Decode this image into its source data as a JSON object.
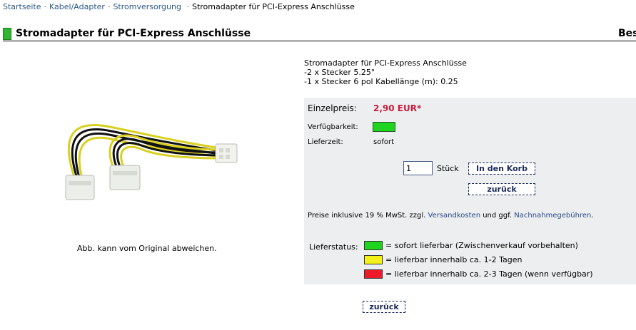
{
  "breadcrumb": {
    "items": [
      "Startseite",
      "Kabel/Adapter",
      "Stromversorgung"
    ],
    "current": "Stromadapter für PCI-Express Anschlüsse",
    "separator": "·"
  },
  "header": {
    "title": "Stromadapter für PCI-Express Anschlüsse",
    "right_text": "Bes"
  },
  "product": {
    "image_caption": "Abb. kann vom Original abweichen.",
    "desc_lines": [
      "Stromadapter für PCI-Express Anschlüsse",
      "-2 x Stecker 5.25\"",
      "-1 x Stecker 6 pol Kabellänge (m): 0.25"
    ]
  },
  "purchase": {
    "price_label": "Einzelpreis:",
    "price": "2,90 EUR*",
    "availability_label": "Verfügbarkeit:",
    "availability_color": "#1ed41e",
    "delivery_label": "Lieferzeit:",
    "delivery_value": "sofort",
    "quantity_value": "1",
    "unit_label": "Stück",
    "cart_button": "In den Korb",
    "back_button": "zurück"
  },
  "note": {
    "prefix": "Preise inklusive 19 % MwSt. zzgl.",
    "shipping_link": "Versandkosten",
    "middle": "und ggf.",
    "cod_link": "Nachnahmegebühren",
    "suffix": "."
  },
  "delivery_status": {
    "label": "Lieferstatus:",
    "items": [
      {
        "color": "#1ed41e",
        "text": "= sofort lieferbar (Zwischenverkauf vorbehalten)"
      },
      {
        "color": "#f2f21a",
        "text": "= lieferbar innerhalb ca. 1-2 Tagen"
      },
      {
        "color": "#ee1a2a",
        "text": "= lieferbar innerhalb ca. 2-3 Tagen  (wenn verfügbar)"
      }
    ]
  },
  "footer": {
    "back_button": "zurück"
  }
}
